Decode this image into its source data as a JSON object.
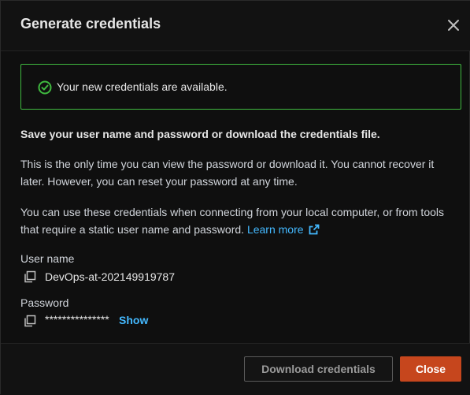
{
  "dialog": {
    "title": "Generate credentials",
    "close_icon": "close-icon"
  },
  "alert": {
    "icon": "check-circle-icon",
    "message": "Your new credentials are available.",
    "color": "#3fb93f"
  },
  "content": {
    "instruction": "Save your user name and password or download the credentials file.",
    "para1": "This is the only time you can view the password or download it. You cannot recover it later. However, you can reset your password at any time.",
    "para2": "You can use these credentials when connecting from your local computer, or from tools that require a static user name and password.",
    "learn_more": "Learn more",
    "learn_more_icon": "external-link-icon",
    "link_color": "#44b9ff"
  },
  "fields": {
    "username": {
      "label": "User name",
      "value": "DevOps-at-202149919787",
      "copy_icon": "copy-icon"
    },
    "password": {
      "label": "Password",
      "value": "***************",
      "show_label": "Show",
      "copy_icon": "copy-icon"
    }
  },
  "footer": {
    "download_label": "Download credentials",
    "close_label": "Close",
    "primary_color": "#c6461d"
  }
}
